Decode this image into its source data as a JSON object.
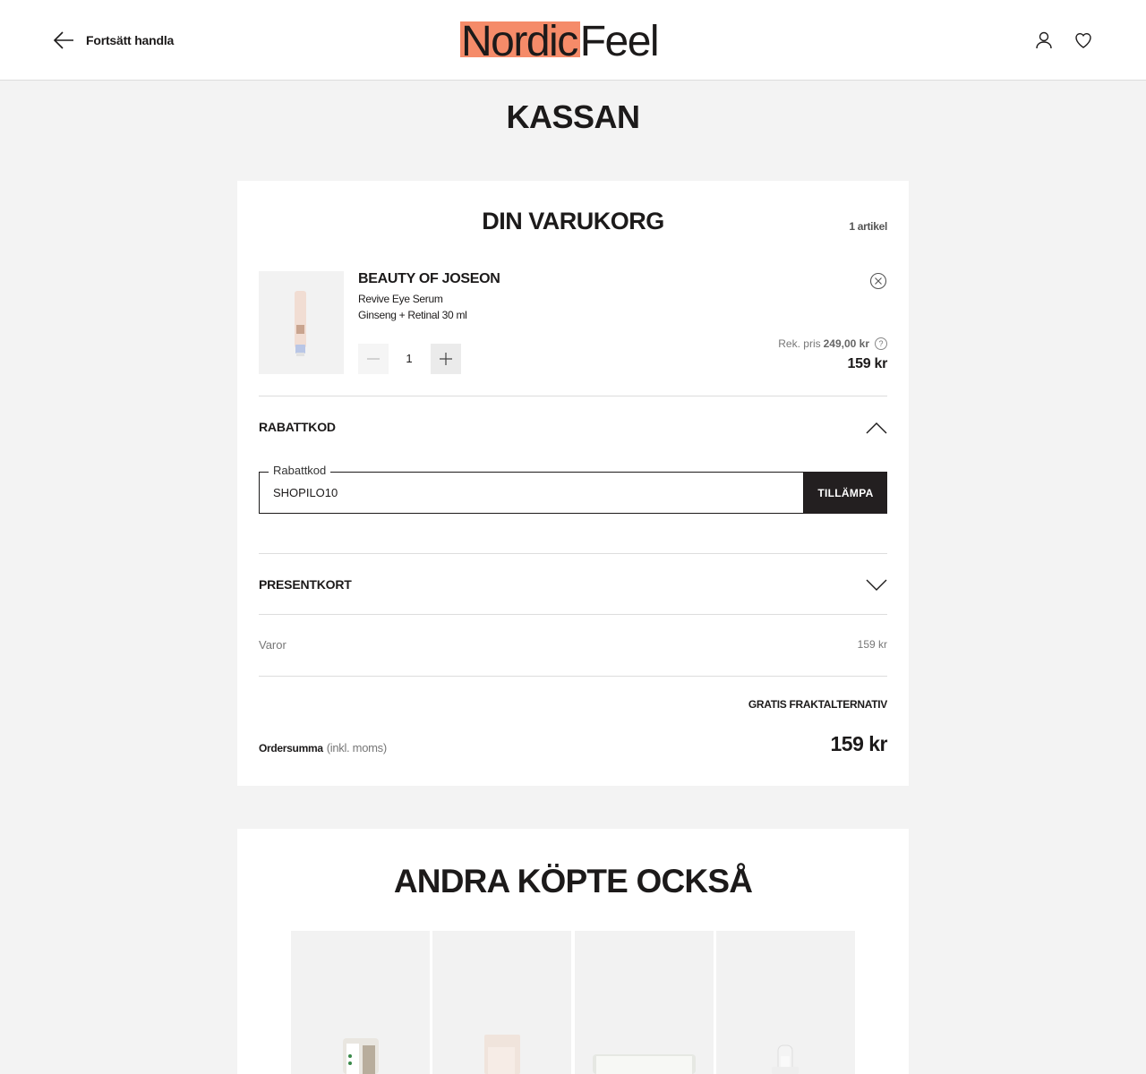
{
  "header": {
    "back_label": "Fortsätt handla",
    "logo_part1": "Nordic",
    "logo_part2": "Feel",
    "logo_accent": "#f58b69"
  },
  "page_title": "KASSAN",
  "cart": {
    "title": "DIN VARUKORG",
    "item_count": "1 artikel",
    "item": {
      "brand": "BEAUTY OF JOSEON",
      "name": "Revive Eye Serum",
      "variant": "Ginseng + Retinal 30 ml",
      "quantity": "1",
      "rek_label": "Rek. pris",
      "rek_price": "249,00 kr",
      "price": "159 kr"
    },
    "discount": {
      "label": "RABATTKOD",
      "field_label": "Rabattkod",
      "value": "SHOPILO10",
      "apply_label": "TILLÄMPA"
    },
    "giftcard_label": "PRESENTKORT",
    "goods_label": "Varor",
    "goods_value": "159 kr",
    "shipping_label": "GRATIS FRAKTALTERNATIV",
    "total_label": "Ordersumma",
    "total_note": "(inkl. moms)",
    "total_value": "159 kr"
  },
  "others": {
    "title": "ANDRA KÖPTE OCKSÅ"
  }
}
